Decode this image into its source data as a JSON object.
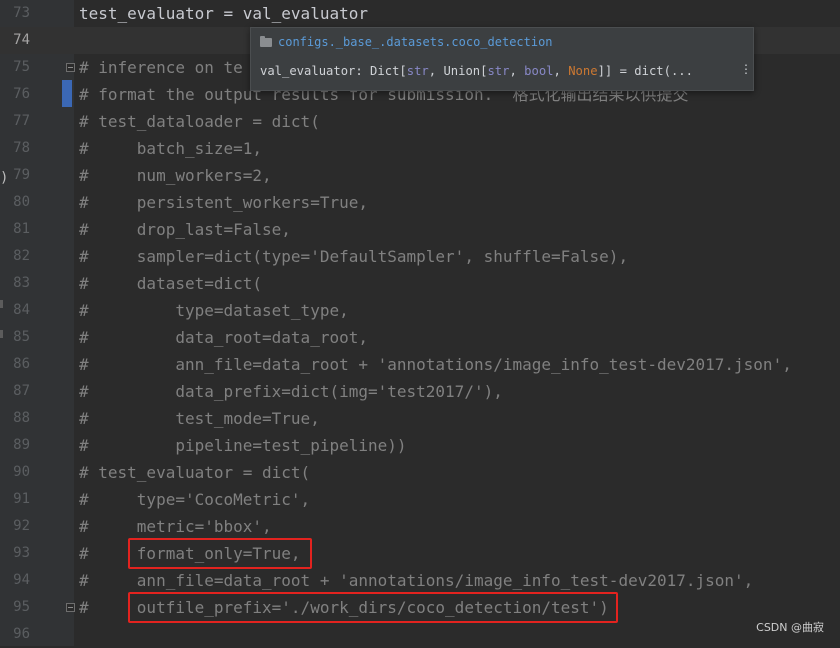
{
  "editor": {
    "lines": [
      {
        "number": "73",
        "text": "test_evaluator = val_evaluator",
        "kind": "code"
      },
      {
        "number": "74",
        "text": "",
        "kind": "code",
        "current": true
      },
      {
        "number": "75",
        "text": "# inference on te",
        "kind": "comment",
        "fold": true
      },
      {
        "number": "76",
        "text": "# format the output results for submission.  格式化输出结果以供提交",
        "kind": "comment"
      },
      {
        "number": "77",
        "text": "# test_dataloader = dict(",
        "kind": "comment"
      },
      {
        "number": "78",
        "text": "#     batch_size=1,",
        "kind": "comment"
      },
      {
        "number": "79",
        "text": "#     num_workers=2,",
        "kind": "comment"
      },
      {
        "number": "80",
        "text": "#     persistent_workers=True,",
        "kind": "comment"
      },
      {
        "number": "81",
        "text": "#     drop_last=False,",
        "kind": "comment"
      },
      {
        "number": "82",
        "text": "#     sampler=dict(type='DefaultSampler', shuffle=False),",
        "kind": "comment"
      },
      {
        "number": "83",
        "text": "#     dataset=dict(",
        "kind": "comment"
      },
      {
        "number": "84",
        "text": "#         type=dataset_type,",
        "kind": "comment"
      },
      {
        "number": "85",
        "text": "#         data_root=data_root,",
        "kind": "comment"
      },
      {
        "number": "86",
        "text": "#         ann_file=data_root + 'annotations/image_info_test-dev2017.json',",
        "kind": "comment"
      },
      {
        "number": "87",
        "text": "#         data_prefix=dict(img='test2017/'),",
        "kind": "comment"
      },
      {
        "number": "88",
        "text": "#         test_mode=True,",
        "kind": "comment"
      },
      {
        "number": "89",
        "text": "#         pipeline=test_pipeline))",
        "kind": "comment"
      },
      {
        "number": "90",
        "text": "# test_evaluator = dict(",
        "kind": "comment"
      },
      {
        "number": "91",
        "text": "#     type='CocoMetric',",
        "kind": "comment"
      },
      {
        "number": "92",
        "text": "#     metric='bbox',",
        "kind": "comment"
      },
      {
        "number": "93",
        "text": "#     format_only=True,",
        "kind": "comment",
        "highlighted": true
      },
      {
        "number": "94",
        "text": "#     ann_file=data_root + 'annotations/image_info_test-dev2017.json',",
        "kind": "comment"
      },
      {
        "number": "95",
        "text": "#     outfile_prefix='./work_dirs/coco_detection/test')",
        "kind": "comment",
        "fold": true,
        "highlighted": true
      },
      {
        "number": "96",
        "text": "",
        "kind": "comment"
      }
    ]
  },
  "popup": {
    "module_path": "configs._base_.datasets.coco_detection",
    "signature_name": "val_evaluator: Dict[",
    "sig_str1": "str",
    "sig_union": ", Union[",
    "sig_str2": "str",
    "sig_comma1": ", ",
    "sig_bool": "bool",
    "sig_comma2": ", ",
    "sig_none": "None",
    "sig_tail": "]] = dict(...",
    "more_icon": "⋮"
  },
  "watermark": "CSDN @曲寂",
  "colors": {
    "highlight_box": "#e3231f",
    "editor_bg": "#2b2b2b",
    "comment": "#808080",
    "link": "#5b9bd8"
  }
}
